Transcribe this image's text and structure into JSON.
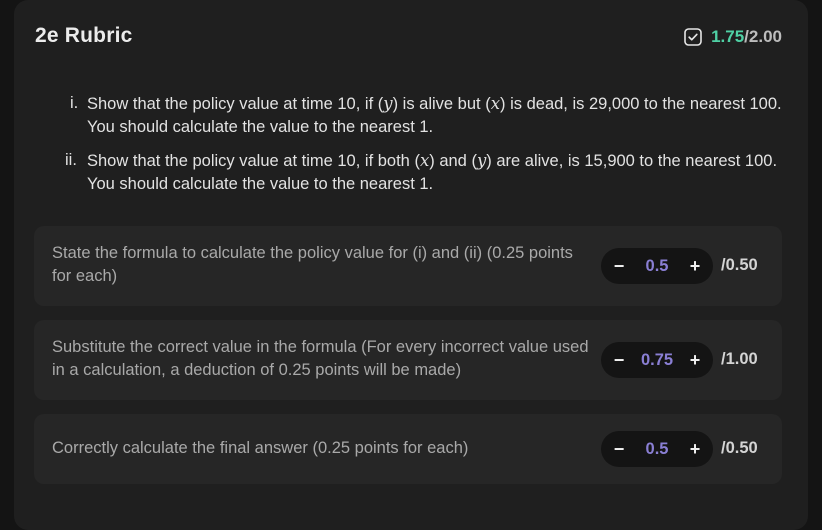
{
  "rubric": {
    "title": "2e Rubric",
    "score": {
      "awarded": "1.75",
      "separator": "/",
      "maximum": "2.00",
      "icon": "checkbox-check-icon",
      "awarded_color": "#4fd1a5"
    }
  },
  "questions": [
    {
      "number": "i.",
      "parts": [
        "Show that the policy value at time 10, if (",
        "y",
        ") is alive but (",
        "x",
        ") is dead, is 29,000 to the nearest 100. You should calculate the value to the nearest 1."
      ]
    },
    {
      "number": "ii.",
      "parts": [
        "Show that the policy value at time 10, if both (",
        "x",
        ") and (",
        "y",
        ") are alive, is 15,900 to the nearest 100. You should calculate the value to the nearest 1."
      ]
    }
  ],
  "criteria": [
    {
      "text": "State the formula to calculate the policy value for (i) and (ii) (0.25 points for each)",
      "value": "0.5",
      "max": "/0.50",
      "minus": "−",
      "plus": "+"
    },
    {
      "text": "Substitute the correct value in the formula (For every incorrect value used in a calculation, a deduction of 0.25 points will be made)",
      "value": "0.75",
      "max": "/1.00",
      "minus": "−",
      "plus": "+"
    },
    {
      "text": "Correctly calculate the final answer (0.25 points for each)",
      "value": "0.5",
      "max": "/0.50",
      "minus": "−",
      "plus": "+"
    }
  ],
  "colors": {
    "accent_value": "#8a7fd4",
    "score_green": "#4fd1a5"
  }
}
